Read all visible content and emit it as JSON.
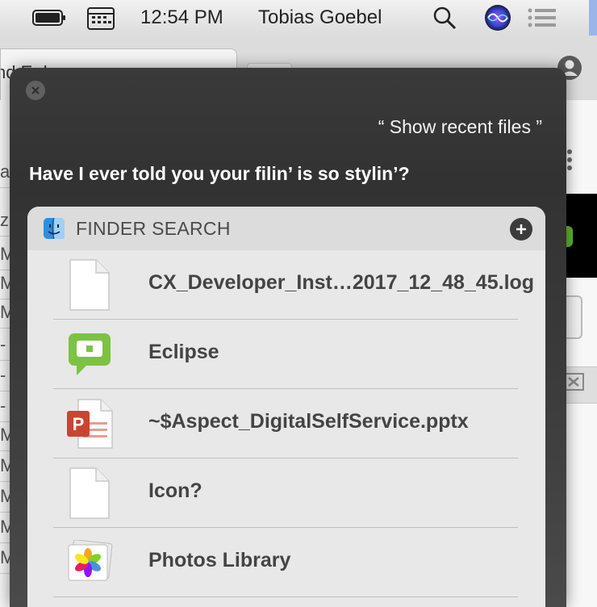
{
  "menubar": {
    "clock": "12:54 PM",
    "user": "Tobias Goebel"
  },
  "browser": {
    "tab_title": "nd      E          d",
    "left_list_letters": [
      "a",
      "z",
      "M",
      "M",
      "M",
      "-",
      "-",
      "-",
      "M",
      "M",
      "M",
      "M",
      "M"
    ]
  },
  "siri": {
    "query": "“ Show recent files ”",
    "reply": "Have I ever told you your filin’ is so stylin’?",
    "card": {
      "title": "FINDER SEARCH",
      "items": [
        {
          "label": "CX_Developer_Inst…2017_12_48_45.log",
          "icon": "document-icon"
        },
        {
          "label": "Eclipse",
          "icon": "eclipse-icon"
        },
        {
          "label": "~$Aspect_DigitalSelfService.pptx",
          "icon": "powerpoint-icon"
        },
        {
          "label": "Icon?",
          "icon": "document-icon"
        },
        {
          "label": "Photos Library",
          "icon": "photos-icon"
        }
      ]
    }
  },
  "colors": {
    "eclipse_green": "#7dc242",
    "powerpoint_red": "#c9452f",
    "siri_panel": "#363636",
    "card_bg": "#e8e8e8"
  }
}
